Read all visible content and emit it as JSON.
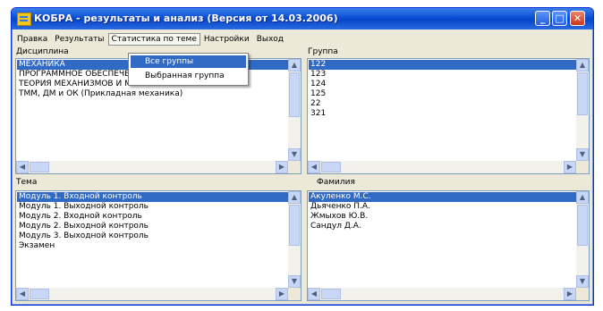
{
  "window": {
    "title": "КОБРА - результаты и анализ (Версия от 14.03.2006)"
  },
  "menu": [
    {
      "label": "Правка"
    },
    {
      "label": "Результаты"
    },
    {
      "label": "Статистика по теме"
    },
    {
      "label": "Настройки"
    },
    {
      "label": "Выход"
    }
  ],
  "dropdown": [
    "Все группы",
    "Выбранная группа"
  ],
  "panels": {
    "discipline": {
      "label": "Дисциплина",
      "items": [
        "МЕХАНИКА",
        "ПРОГРАММНОЕ ОБЕСПЕЧЕНИЕ ПРИ ПРОЕКТИРОВАНИИ",
        "ТЕОРИЯ МЕХАНИЗМОВ И МАШИН",
        "ТММ, ДМ и ОК (Прикладная механика)"
      ],
      "selected": 0
    },
    "group": {
      "label": "Группа",
      "items": [
        "122",
        "123",
        "124",
        "125",
        "22",
        "321"
      ],
      "selected": 0
    },
    "topic": {
      "label": "Тема",
      "items": [
        "Модуль 1. Входной контроль",
        "Модуль 1. Выходной контроль",
        "Модуль 2. Входной контроль",
        "Модуль 2. Выходной контроль",
        "Модуль 3. Выходной контроль",
        "Экзамен"
      ],
      "selected": 0
    },
    "surname": {
      "label": "Фамилия",
      "items": [
        "Акуленко М.С.",
        "Дьяченко П.А.",
        "Жмыхов Ю.В.",
        "Сандул Д.А."
      ],
      "selected": 0
    }
  },
  "colors": {
    "selection": "#316ac5",
    "titlebar": "#0a4fd4",
    "face": "#ece9d8"
  }
}
